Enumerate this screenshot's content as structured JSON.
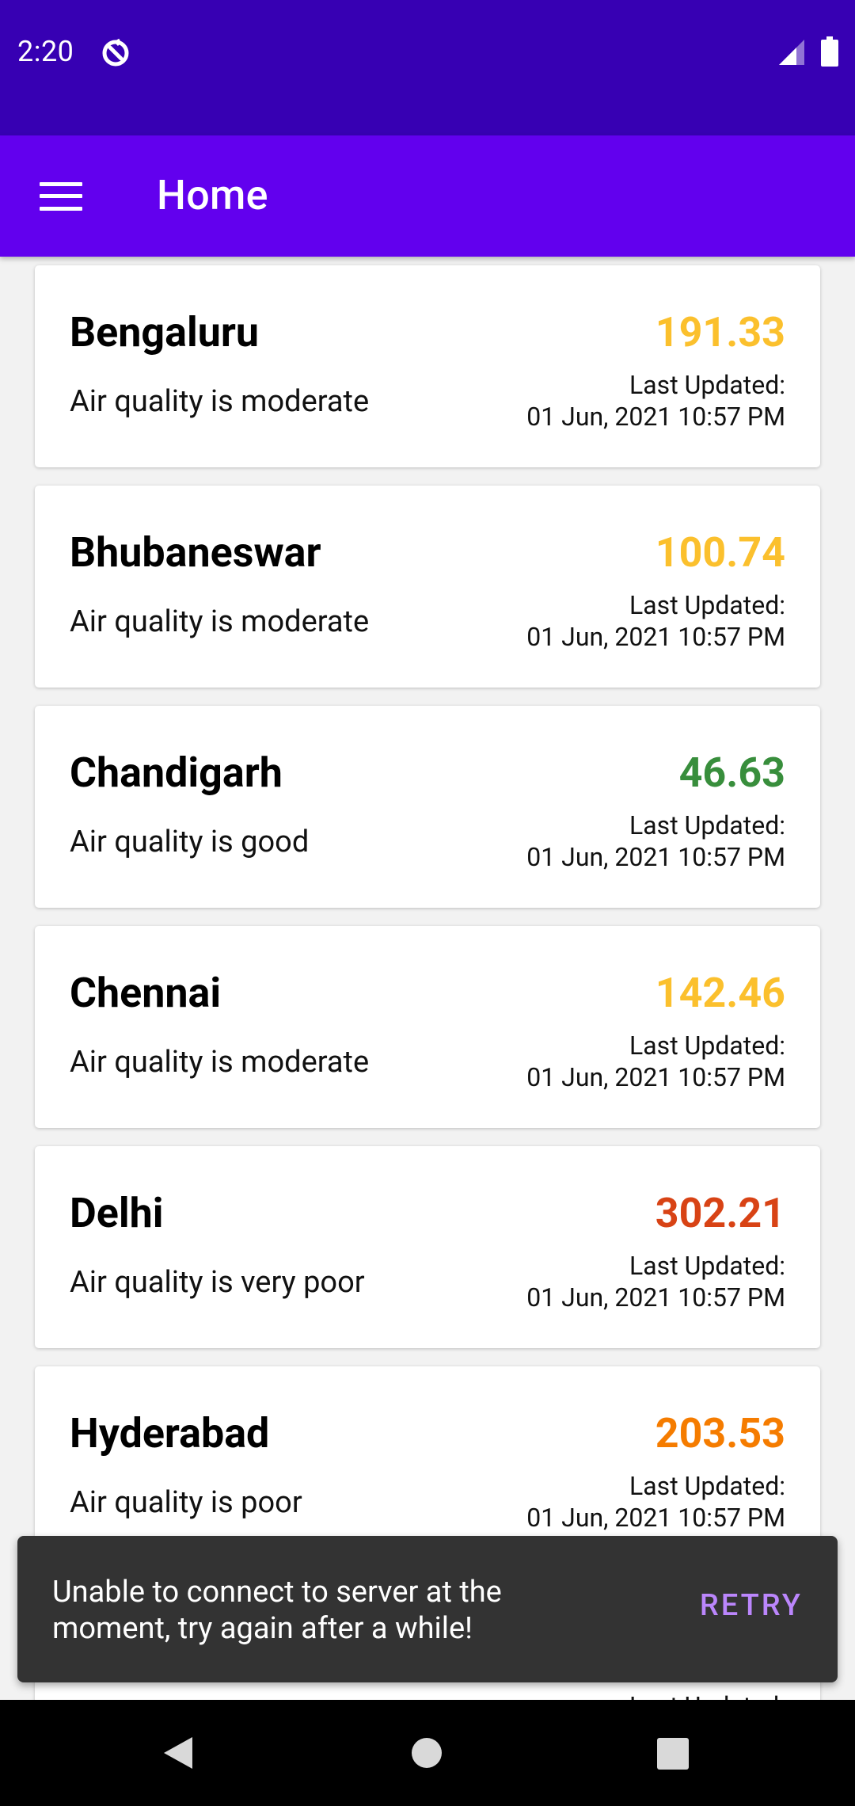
{
  "status_bar": {
    "time": "2:20",
    "icons": [
      "sync-icon",
      "signal-icon",
      "battery-icon"
    ]
  },
  "app_bar": {
    "title": "Home",
    "menu_icon": "menu-icon"
  },
  "colors": {
    "status_bar": "#3700b3",
    "app_bar": "#6200ee",
    "moderate": "#fbc02d",
    "good": "#388e3c",
    "poor": "#f57c00",
    "very_poor": "#d84315",
    "snackbar_action": "#bb86fc"
  },
  "cities": [
    {
      "name": "Bengaluru",
      "quality": "Air quality is moderate",
      "aqi": "191.33",
      "aqi_color": "#fbc02d",
      "updated_label": "Last Updated:",
      "updated_time": "01 Jun, 2021 10:57 PM"
    },
    {
      "name": "Bhubaneswar",
      "quality": "Air quality is moderate",
      "aqi": "100.74",
      "aqi_color": "#fbc02d",
      "updated_label": "Last Updated:",
      "updated_time": "01 Jun, 2021 10:57 PM"
    },
    {
      "name": "Chandigarh",
      "quality": "Air quality is good",
      "aqi": "46.63",
      "aqi_color": "#388e3c",
      "updated_label": "Last Updated:",
      "updated_time": "01 Jun, 2021 10:57 PM"
    },
    {
      "name": "Chennai",
      "quality": "Air quality is moderate",
      "aqi": "142.46",
      "aqi_color": "#fbc02d",
      "updated_label": "Last Updated:",
      "updated_time": "01 Jun, 2021 10:57 PM"
    },
    {
      "name": "Delhi",
      "quality": "Air quality is very poor",
      "aqi": "302.21",
      "aqi_color": "#d84315",
      "updated_label": "Last Updated:",
      "updated_time": "01 Jun, 2021 10:57 PM"
    },
    {
      "name": "Hyderabad",
      "quality": "Air quality is poor",
      "aqi": "203.53",
      "aqi_color": "#f57c00",
      "updated_label": "Last Updated:",
      "updated_time": "01 Jun, 2021 10:57 PM"
    }
  ],
  "partial_card": {
    "updated_label": "Last Updated:"
  },
  "snackbar": {
    "message": "Unable to connect to server at the moment, try again after a while!",
    "action": "RETRY"
  },
  "nav_bar": {
    "icons": [
      "back-icon",
      "home-icon",
      "recents-icon"
    ]
  }
}
